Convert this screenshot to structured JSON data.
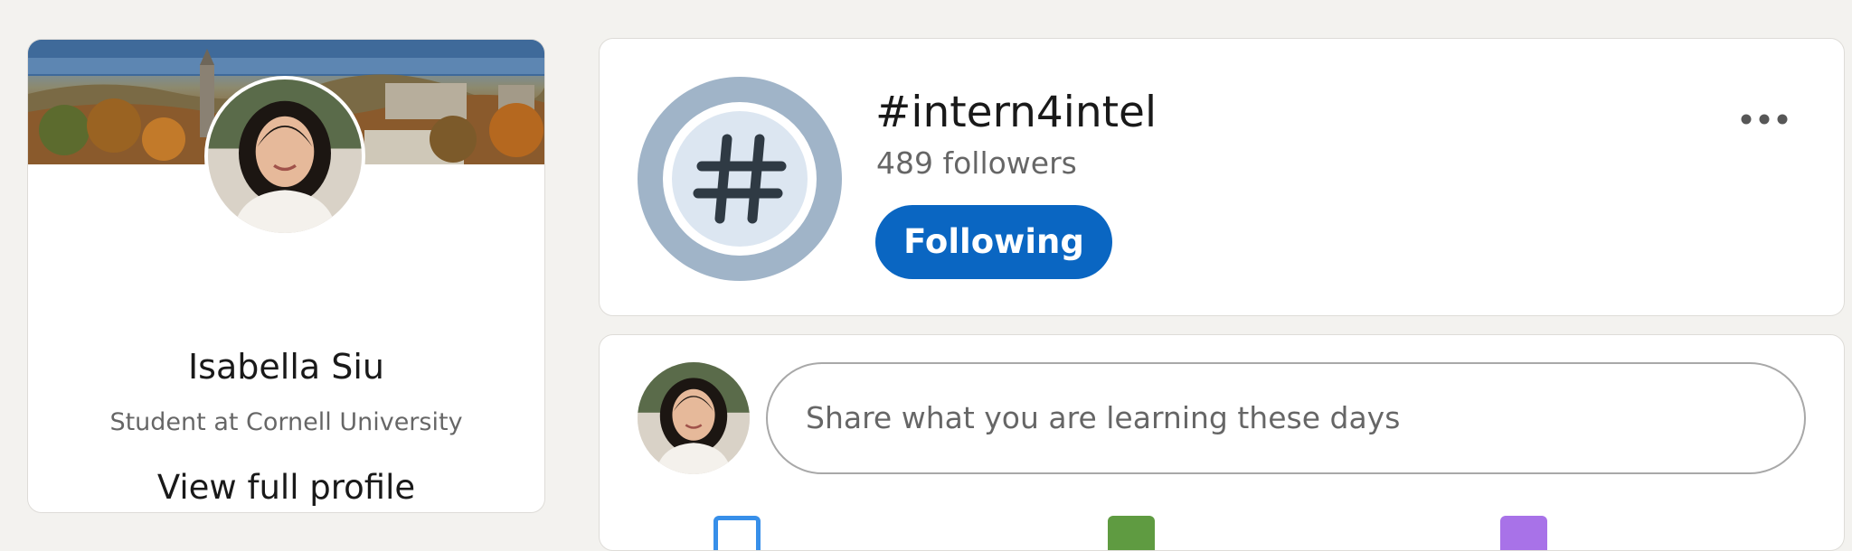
{
  "profile": {
    "name": "Isabella Siu",
    "headline": "Student at Cornell University",
    "view_profile_label": "View full profile"
  },
  "hashtag": {
    "title": "#intern4intel",
    "followers": "489 followers",
    "following_label": "Following",
    "more_icon": "ellipsis-icon"
  },
  "share_box": {
    "placeholder": "Share what you are learning these days",
    "media_icons": [
      "photo-icon",
      "video-icon",
      "event-icon"
    ]
  },
  "colors": {
    "primary_blue": "#0a66c2",
    "page_background": "#f3f2ef",
    "hashtag_ring": "#a0b4c8",
    "hashtag_core": "#dce6f1",
    "photo_blue": "#378fe9",
    "video_green": "#5f9b41",
    "event_purple": "#a872e8"
  }
}
